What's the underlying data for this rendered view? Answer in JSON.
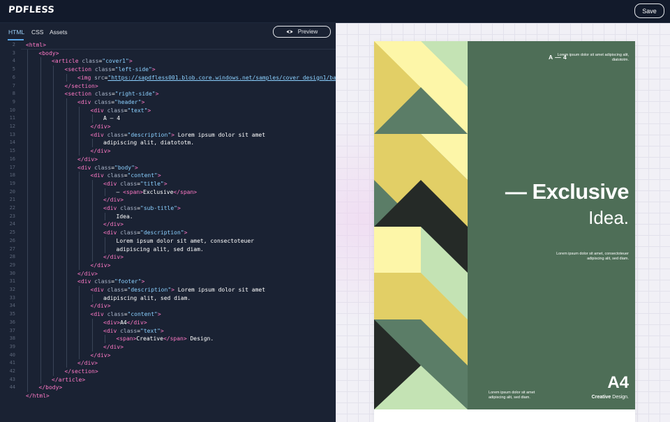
{
  "app": {
    "logo": "PDFLESS",
    "save_label": "Save"
  },
  "editor": {
    "tabs": [
      {
        "label": "HTML",
        "active": true
      },
      {
        "label": "CSS"
      },
      {
        "label": "Assets"
      }
    ],
    "preview_label": "Preview",
    "line_numbers": [
      "2",
      "3",
      "4",
      "5",
      "6",
      "7",
      "8",
      "9",
      "10",
      "11",
      "12",
      "13",
      "14",
      "15",
      "16",
      "17",
      "18",
      "19",
      "20",
      "21",
      "22",
      "23",
      "24",
      "25",
      "26",
      "27",
      "28",
      "29",
      "30",
      "31",
      "32",
      "33",
      "34",
      "35",
      "36",
      "37",
      "38",
      "39",
      "40",
      "41",
      "42",
      "43",
      "44"
    ],
    "code_lines": [
      [
        [
          "t",
          "<html>"
        ]
      ],
      [
        [
          "t",
          "<body>"
        ]
      ],
      [
        [
          "t",
          "<article "
        ],
        [
          "a",
          "class"
        ],
        [
          "x",
          "="
        ],
        [
          "s",
          "\"cover1\""
        ],
        [
          "t",
          ">"
        ]
      ],
      [
        [
          "t",
          "<section "
        ],
        [
          "a",
          "class"
        ],
        [
          "x",
          "="
        ],
        [
          "s",
          "\"left-side\""
        ],
        [
          "t",
          ">"
        ]
      ],
      [
        [
          "t",
          "<img "
        ],
        [
          "a",
          "src"
        ],
        [
          "x",
          "="
        ],
        [
          "su",
          "\"https://sapdfless001.blob.core.windows.net/samples/cover design1/back"
        ]
      ],
      [
        [
          "t",
          "</section>"
        ]
      ],
      [
        [
          "t",
          "<section "
        ],
        [
          "a",
          "class"
        ],
        [
          "x",
          "="
        ],
        [
          "s",
          "\"right-side\""
        ],
        [
          "t",
          ">"
        ]
      ],
      [
        [
          "t",
          "<div "
        ],
        [
          "a",
          "class"
        ],
        [
          "x",
          "="
        ],
        [
          "s",
          "\"header\""
        ],
        [
          "t",
          ">"
        ]
      ],
      [
        [
          "t",
          "<div "
        ],
        [
          "a",
          "class"
        ],
        [
          "x",
          "="
        ],
        [
          "s",
          "\"text\""
        ],
        [
          "t",
          ">"
        ]
      ],
      [
        [
          "x",
          "A — 4"
        ]
      ],
      [
        [
          "t",
          "</div>"
        ]
      ],
      [
        [
          "t",
          "<div "
        ],
        [
          "a",
          "class"
        ],
        [
          "x",
          "="
        ],
        [
          "s",
          "\"description\""
        ],
        [
          "t",
          ">"
        ],
        [
          "x",
          " Lorem ipsum dolor sit amet"
        ]
      ],
      [
        [
          "x",
          "adipiscing alit, diatototm."
        ]
      ],
      [
        [
          "t",
          "</div>"
        ]
      ],
      [
        [
          "t",
          "</div>"
        ]
      ],
      [
        [
          "t",
          "<div "
        ],
        [
          "a",
          "class"
        ],
        [
          "x",
          "="
        ],
        [
          "s",
          "\"body\""
        ],
        [
          "t",
          ">"
        ]
      ],
      [
        [
          "t",
          "<div "
        ],
        [
          "a",
          "class"
        ],
        [
          "x",
          "="
        ],
        [
          "s",
          "\"content\""
        ],
        [
          "t",
          ">"
        ]
      ],
      [
        [
          "t",
          "<div "
        ],
        [
          "a",
          "class"
        ],
        [
          "x",
          "="
        ],
        [
          "s",
          "\"title\""
        ],
        [
          "t",
          ">"
        ]
      ],
      [
        [
          "x",
          "— "
        ],
        [
          "t",
          "<span>"
        ],
        [
          "x",
          "Exclusive"
        ],
        [
          "t",
          "</span>"
        ]
      ],
      [
        [
          "t",
          "</div>"
        ]
      ],
      [
        [
          "t",
          "<div "
        ],
        [
          "a",
          "class"
        ],
        [
          "x",
          "="
        ],
        [
          "s",
          "\"sub-title\""
        ],
        [
          "t",
          ">"
        ]
      ],
      [
        [
          "x",
          "Idea."
        ]
      ],
      [
        [
          "t",
          "</div>"
        ]
      ],
      [
        [
          "t",
          "<div "
        ],
        [
          "a",
          "class"
        ],
        [
          "x",
          "="
        ],
        [
          "s",
          "\"description\""
        ],
        [
          "t",
          ">"
        ]
      ],
      [
        [
          "x",
          "Lorem ipsum dolor sit amet, consectoteuer"
        ]
      ],
      [
        [
          "x",
          "adipiscing alit, sed diam."
        ]
      ],
      [
        [
          "t",
          "</div>"
        ]
      ],
      [
        [
          "t",
          "</div>"
        ]
      ],
      [
        [
          "t",
          "</div>"
        ]
      ],
      [
        [
          "t",
          "<div "
        ],
        [
          "a",
          "class"
        ],
        [
          "x",
          "="
        ],
        [
          "s",
          "\"footer\""
        ],
        [
          "t",
          ">"
        ]
      ],
      [
        [
          "t",
          "<div "
        ],
        [
          "a",
          "class"
        ],
        [
          "x",
          "="
        ],
        [
          "s",
          "\"description\""
        ],
        [
          "t",
          ">"
        ],
        [
          "x",
          " Lorem ipsum dolor sit amet"
        ]
      ],
      [
        [
          "x",
          "adipiscing alit, sed diam."
        ]
      ],
      [
        [
          "t",
          "</div>"
        ]
      ],
      [
        [
          "t",
          "<div "
        ],
        [
          "a",
          "class"
        ],
        [
          "x",
          "="
        ],
        [
          "s",
          "\"content\""
        ],
        [
          "t",
          ">"
        ]
      ],
      [
        [
          "t",
          "<div>"
        ],
        [
          "x",
          "A4"
        ],
        [
          "t",
          "</div>"
        ]
      ],
      [
        [
          "t",
          "<div "
        ],
        [
          "a",
          "class"
        ],
        [
          "x",
          "="
        ],
        [
          "s",
          "\"text\""
        ],
        [
          "t",
          ">"
        ]
      ],
      [
        [
          "t",
          "<span>"
        ],
        [
          "x",
          "Creative"
        ],
        [
          "t",
          "</span>"
        ],
        [
          "x",
          " Design."
        ]
      ],
      [
        [
          "t",
          "</div>"
        ]
      ],
      [
        [
          "t",
          "</div>"
        ]
      ],
      [
        [
          "t",
          "</div>"
        ]
      ],
      [
        [
          "t",
          "</section>"
        ]
      ],
      [
        [
          "t",
          "</article>"
        ]
      ],
      [
        [
          "t",
          "</body>"
        ]
      ],
      [
        [
          "t",
          "</html>"
        ]
      ]
    ]
  },
  "preview": {
    "header_text": "A — 4",
    "header_desc": "Lorem ipsum dolor sit amet adipiscing alit, diatototm.",
    "title": "— Exclusive",
    "sub_title": "Idea.",
    "body_desc": "Lorem ipsum dolor sit amet, consectoteuer adipiscing alit, sed diam.",
    "footer_desc": "Lorem ipsum dolor sit amet adipiscing alit, sed diam.",
    "footer_a4": "A4",
    "footer_text_strong": "Creative",
    "footer_text_rest": " Design.",
    "colors": {
      "panel_green": "#4e6e57",
      "pattern_yellow_light": "#fdf6a8",
      "pattern_yellow": "#e2cf66",
      "pattern_mint": "#c4e3b4",
      "pattern_green": "#5b7d67",
      "pattern_dark": "#252a27"
    }
  }
}
